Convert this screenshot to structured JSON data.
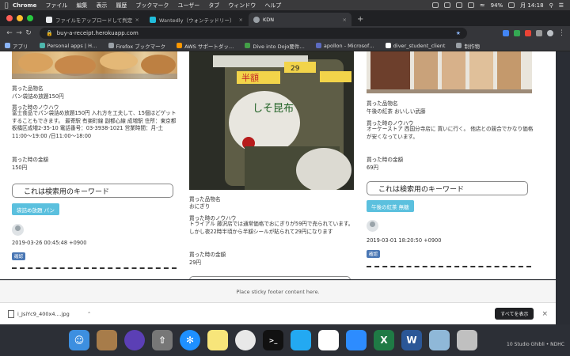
{
  "menubar": {
    "app": "Chrome",
    "items": [
      "ファイル",
      "編集",
      "表示",
      "履歴",
      "ブックマーク",
      "ユーザー",
      "タブ",
      "ウィンドウ",
      "ヘルプ"
    ],
    "battery": "94%",
    "clock": "月 14:18"
  },
  "tabs": [
    {
      "title": "ファイルをアップロードして判定…",
      "favicon_color": "#e8eaed"
    },
    {
      "title": "Wantedly（ウォンテッドリー）",
      "favicon_color": "#21bddb"
    },
    {
      "title": "KDN",
      "favicon_color": "#9aa0a6"
    }
  ],
  "address_bar": {
    "url": "buy-a-receipt.herokuapp.com"
  },
  "bookmarks": [
    {
      "label": "アプリ",
      "icon_color": "#8ab4f8"
    },
    {
      "label": "Personal apps | H…",
      "icon_color": "#4db6ac"
    },
    {
      "label": "Firefox ブックマーク",
      "icon_color": "#9aa0a6"
    },
    {
      "label": "AWS サポートダッ…",
      "icon_color": "#ff9800"
    },
    {
      "label": "Dive into Dojo要件…",
      "icon_color": "#43a047"
    },
    {
      "label": "apollon - Microsof…",
      "icon_color": "#5c6bc0"
    },
    {
      "label": "diver_student_client",
      "icon_color": "#ffffff"
    },
    {
      "label": "制作物",
      "icon_color": "#9aa0a6"
    }
  ],
  "cards": [
    {
      "item_heading": "買った品物名",
      "item_value": "パン袋詰め放題150円",
      "knowhow_heading": "買った時のノウハウ",
      "knowhow_text": "富士食品でパン袋詰め放題150円 入れ方を工夫して、15個ほどゲットすることもできます。 最寄駅 有楽町線 副都心線 成増駅 住所：東京都板橋区成増2-35-10 電話番号：03-3938-1021 営業時間：月-土11:00〜19:00 /日11:00〜18:00",
      "price_heading": "買った時の金額",
      "price_value": "150円",
      "keyword_label": "これは検索用のキーワード",
      "tag_label": "袋詰め放題 パン",
      "timestamp": "2019-03-26 00:45:48 +0900",
      "badge": "確認"
    },
    {
      "item_heading": "買った品物名",
      "item_value": "おにぎり",
      "knowhow_heading": "買った時のノウハウ",
      "knowhow_text": "トライアル 藤沢店では通常価格でおにぎりが59円で売られています。 しかし夜22時半頃から半額シールが貼られて29円になります",
      "price_heading": "買った時の金額",
      "price_value": "29円"
    },
    {
      "item_heading": "買った品物名",
      "item_value": "午後の紅茶 おいしい武藤",
      "knowhow_heading": "買った時のノウハウ",
      "knowhow_text": "オーケーストア 西国分寺店に 買いに行く。 他店との競合でかなり価格が安くなっています。",
      "price_heading": "買った時の金額",
      "price_value": "69円",
      "keyword_label": "これは検索用のキーワード",
      "tag_label": "午後の紅茶 無糖",
      "timestamp": "2019-03-01 18:20:50 +0900",
      "badge": "確認"
    }
  ],
  "rice_ball_labels": {
    "sticker": "半額",
    "price": "29",
    "flavor": "しそ昆布"
  },
  "footer_text": "Place sticky footer content here.",
  "download": {
    "filename": "i_JsiYc9_400x4....jpg",
    "show_all": "すべてを表示"
  },
  "dock": {
    "trailing_text": "10 Studio Ghibli • NDHC"
  }
}
